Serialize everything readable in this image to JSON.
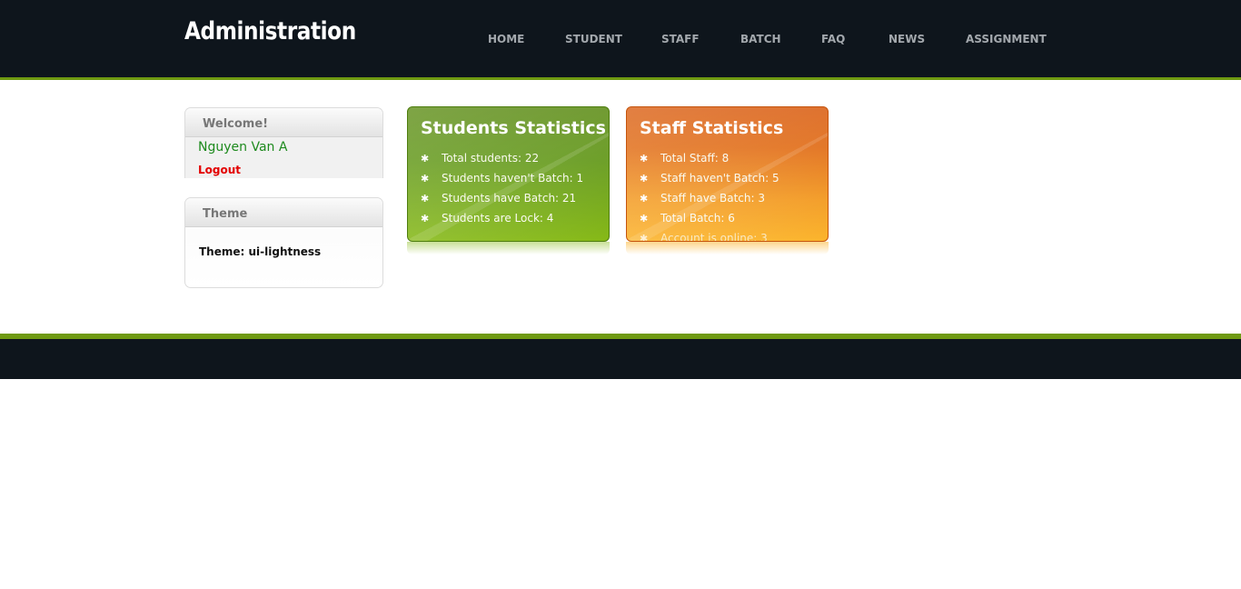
{
  "header": {
    "title": "Administration",
    "nav": [
      "HOME",
      "STUDENT",
      "STAFF",
      "BATCH",
      "FAQ",
      "NEWS",
      "ASSIGNMENT"
    ]
  },
  "sidebar": {
    "welcome": {
      "heading": "Welcome!",
      "user_name": "Nguyen Van A",
      "logout_label": "Logout"
    },
    "theme": {
      "heading": "Theme",
      "text": "Theme: ui-lightness"
    }
  },
  "students_stats": {
    "title": "Students Statistics",
    "items": [
      "Total students: 22",
      "Students haven't Batch: 1",
      "Students have Batch: 21",
      "Students are Lock: 4"
    ]
  },
  "staff_stats": {
    "title": "Staff Statistics",
    "items": [
      "Total Staff: 8",
      "Staff haven't Batch: 5",
      "Staff have Batch: 3",
      "Total Batch: 6",
      "Account is online: 3"
    ]
  },
  "icons": {
    "bullet": "gear-bullet-icon"
  },
  "colors": {
    "header_bg": "#0e151c",
    "accent_green": "#6f9a12",
    "username_green": "#1d8a1d",
    "logout_red": "#e30000",
    "stat_green": "#5f9614",
    "stat_orange": "#e0680f"
  }
}
